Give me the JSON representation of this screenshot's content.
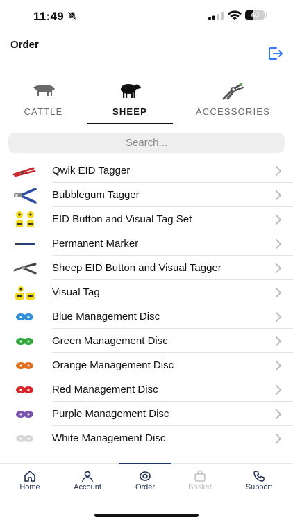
{
  "status_bar": {
    "time": "11:49",
    "battery": "40"
  },
  "header": {
    "title": "Order"
  },
  "tabs": [
    {
      "label": "CATTLE",
      "active": false,
      "icon": "cow-icon"
    },
    {
      "label": "SHEEP",
      "active": true,
      "icon": "sheep-icon"
    },
    {
      "label": "ACCESSORIES",
      "active": false,
      "icon": "pliers-icon"
    }
  ],
  "search": {
    "placeholder": "Search..."
  },
  "products": [
    {
      "name": "Qwik EID Tagger",
      "icon": "red-tagger-icon"
    },
    {
      "name": "Bubblegum Tagger",
      "icon": "blue-tagger-icon"
    },
    {
      "name": "EID Button and Visual Tag Set",
      "icon": "yellow-tag-set-icon"
    },
    {
      "name": "Permanent Marker",
      "icon": "marker-icon"
    },
    {
      "name": "Sheep EID Button and Visual Tagger",
      "icon": "grey-tagger-icon"
    },
    {
      "name": "Visual Tag",
      "icon": "yellow-visual-tag-icon"
    },
    {
      "name": "Blue Management Disc",
      "icon": "blue-disc-icon",
      "color": "#2f8fd8"
    },
    {
      "name": "Green Management Disc",
      "icon": "green-disc-icon",
      "color": "#2fa83a"
    },
    {
      "name": "Orange Management Disc",
      "icon": "orange-disc-icon",
      "color": "#e0701f"
    },
    {
      "name": "Red Management Disc",
      "icon": "red-disc-icon",
      "color": "#d8262b"
    },
    {
      "name": "Purple Management Disc",
      "icon": "purple-disc-icon",
      "color": "#7a55b0"
    },
    {
      "name": "White Management Disc",
      "icon": "white-disc-icon",
      "color": "#d6d6d6"
    }
  ],
  "bottom_nav": [
    {
      "label": "Home",
      "icon": "home-icon"
    },
    {
      "label": "Account",
      "icon": "account-icon"
    },
    {
      "label": "Order",
      "icon": "order-icon",
      "active": true
    },
    {
      "label": "Basket",
      "icon": "basket-icon",
      "disabled": true
    },
    {
      "label": "Support",
      "icon": "phone-icon"
    }
  ],
  "colors": {
    "accent": "#3478f6",
    "nav_text": "#1f2d55"
  }
}
